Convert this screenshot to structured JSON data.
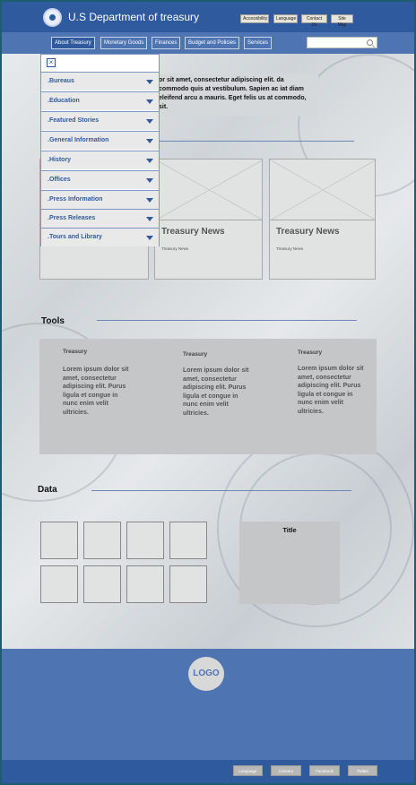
{
  "header": {
    "site_title": "U.S Department of treasury",
    "utility_links": [
      "Accessibility",
      "Language",
      "Contact Us",
      "Site Map"
    ]
  },
  "nav": {
    "items": [
      "About Treasury",
      "Monetary Goods",
      "Finances",
      "Budget and Policies",
      "Services"
    ],
    "active": "About Treasury",
    "search_placeholder": ""
  },
  "hero": {
    "text": "or sit amet, consectetur adipiscing elit. da commodo quis at vestibulum. Sapien ac iat diam eleifend arcu a mauris. Eget felis us at commodo, sit."
  },
  "dropdown": {
    "close_label": "×",
    "items": [
      ".Bureaus",
      ".Education",
      ".Featured Stories",
      ".General Information",
      ".History",
      ".Offices",
      ".Press Information",
      ".Press Releases",
      ".Tours and Library"
    ]
  },
  "cards": [
    {
      "title": "",
      "subtitle": ""
    },
    {
      "title": "Treasury News",
      "subtitle": "Treasury News"
    },
    {
      "title": "Treasury News",
      "subtitle": "Treasury News"
    }
  ],
  "tools": {
    "title": "Tools",
    "columns": [
      {
        "title": "Treasury",
        "text": "Lorem ipsum dolor sit amet, consectetur adipiscing elit. Purus ligula et congue in nunc enim velit ultricies."
      },
      {
        "title": "Treasury",
        "text": "Lorem ipsum dolor sit amet, consectetur adipiscing elit. Purus ligula et congue in nunc enim velit ultricies."
      },
      {
        "title": "Treasury",
        "text": "Lorem ipsum dolor sit amet, consectetur adipiscing elit. Purus ligula et congue in nunc enim velit ultricies."
      }
    ]
  },
  "data_section": {
    "title": "Data",
    "panel_title": "Title",
    "tile_count": 8
  },
  "footer": {
    "logo": "LOGO",
    "links": [
      "Language",
      "Careers",
      "Facebook",
      "Twitter"
    ]
  },
  "colors": {
    "header_blue": "#2f5a9e",
    "nav_blue": "#4e74b2",
    "panel_gray": "#c5c6c7"
  }
}
